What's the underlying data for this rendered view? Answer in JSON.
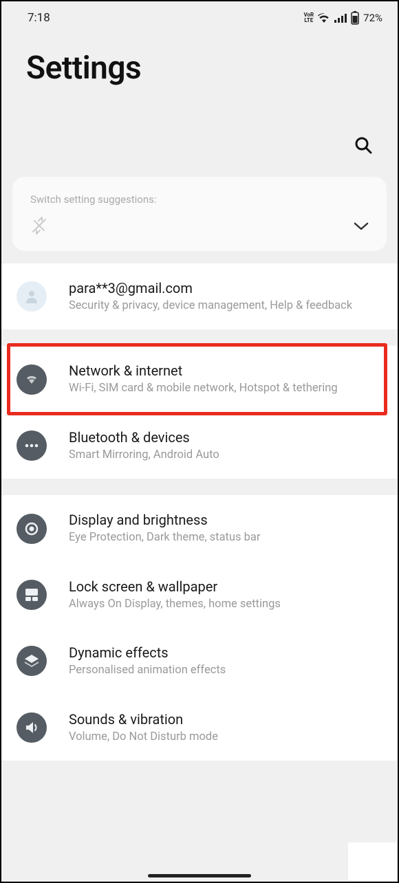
{
  "status": {
    "time": "7:18",
    "battery": "72%"
  },
  "header": {
    "title": "Settings"
  },
  "suggestions": {
    "title": "Switch setting suggestions:"
  },
  "account": {
    "email": "para**3@gmail.com",
    "sub": "Security & privacy, device management, Help & feedback"
  },
  "groups": [
    {
      "items": [
        {
          "title": "Network & internet",
          "sub": "Wi-Fi, SIM card & mobile network, Hotspot & tethering",
          "highlight": true
        },
        {
          "title": "Bluetooth & devices",
          "sub": "Smart Mirroring, Android Auto"
        }
      ]
    },
    {
      "items": [
        {
          "title": "Display and brightness",
          "sub": "Eye Protection, Dark theme, status bar"
        },
        {
          "title": "Lock screen & wallpaper",
          "sub": "Always On Display, themes, home settings"
        },
        {
          "title": "Dynamic effects",
          "sub": "Personalised animation effects"
        },
        {
          "title": "Sounds & vibration",
          "sub": "Volume, Do Not Disturb mode"
        }
      ]
    }
  ]
}
